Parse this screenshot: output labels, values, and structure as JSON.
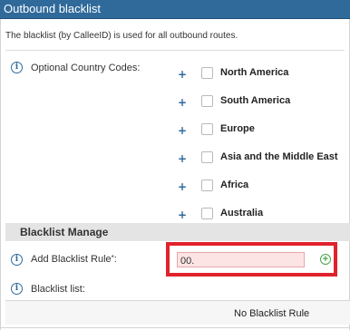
{
  "header": {
    "title": "Outbound blacklist"
  },
  "description": "The blacklist (by CalleeID) is used for all outbound routes.",
  "country_codes": {
    "label": "Optional Country Codes:",
    "items": [
      {
        "name": "North America"
      },
      {
        "name": "South America"
      },
      {
        "name": "Europe"
      },
      {
        "name": "Asia and the Middle East"
      },
      {
        "name": "Africa"
      },
      {
        "name": "Australia"
      }
    ]
  },
  "manage": {
    "section_title": "Blacklist Manage",
    "add_rule_label": "Add Blacklist Rule",
    "required_mark": "*",
    "label_suffix": ":",
    "add_rule_value": "00.",
    "list_label": "Blacklist list:",
    "empty_message": "No Blacklist Rule"
  },
  "colors": {
    "header_bg": "#2f6a9b",
    "highlight": "#e0222c",
    "input_invalid_bg": "#fde4e4",
    "add_icon": "#4aa64a"
  },
  "icons": {
    "info": "i",
    "expand": "+",
    "add": "+"
  }
}
